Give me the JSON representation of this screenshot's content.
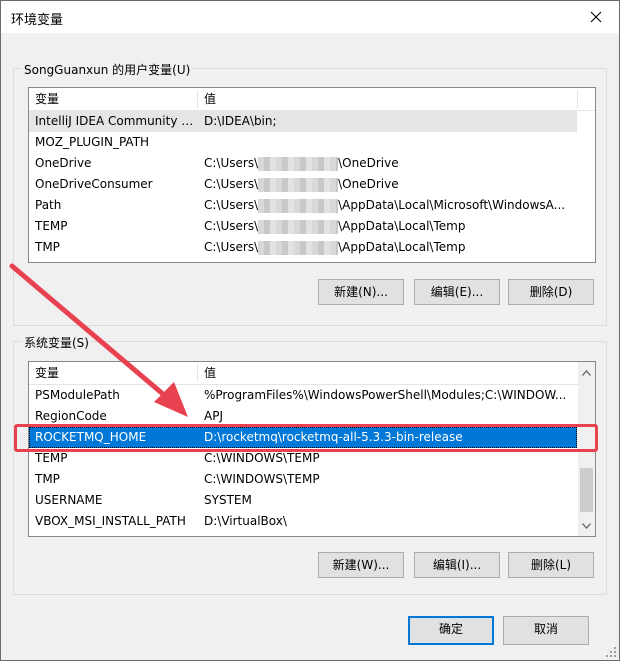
{
  "window": {
    "title": "环境变量"
  },
  "user_vars": {
    "group_label": "SongGuanxun 的用户变量(U)",
    "columns": [
      "变量",
      "值"
    ],
    "rows": [
      {
        "name": "IntelliJ IDEA Community E...",
        "value_prefix": "D:\\IDEA\\bin;",
        "value_suffix": "",
        "masked": false
      },
      {
        "name": "MOZ_PLUGIN_PATH",
        "value_prefix": "",
        "value_suffix": "",
        "masked": false
      },
      {
        "name": "OneDrive",
        "value_prefix": "C:\\Users\\",
        "value_suffix": "\\OneDrive",
        "masked": true
      },
      {
        "name": "OneDriveConsumer",
        "value_prefix": "C:\\Users\\",
        "value_suffix": "\\OneDrive",
        "masked": true
      },
      {
        "name": "Path",
        "value_prefix": "C:\\Users\\",
        "value_suffix": "\\AppData\\Local\\Microsoft\\WindowsA...",
        "masked": true
      },
      {
        "name": "TEMP",
        "value_prefix": "C:\\Users\\",
        "value_suffix": "\\AppData\\Local\\Temp",
        "masked": true
      },
      {
        "name": "TMP",
        "value_prefix": "C:\\Users\\",
        "value_suffix": "\\AppData\\Local\\Temp",
        "masked": true
      }
    ],
    "buttons": {
      "new": "新建(N)...",
      "edit": "编辑(E)...",
      "delete": "删除(D)"
    }
  },
  "system_vars": {
    "group_label": "系统变量(S)",
    "columns": [
      "变量",
      "值"
    ],
    "rows": [
      {
        "name": "PSModulePath",
        "value": "%ProgramFiles%\\WindowsPowerShell\\Modules;C:\\WINDOW..."
      },
      {
        "name": "RegionCode",
        "value": "APJ"
      },
      {
        "name": "ROCKETMQ_HOME",
        "value": "D:\\rocketmq\\rocketmq-all-5.3.3-bin-release"
      },
      {
        "name": "TEMP",
        "value": "C:\\WINDOWS\\TEMP"
      },
      {
        "name": "TMP",
        "value": "C:\\WINDOWS\\TEMP"
      },
      {
        "name": "USERNAME",
        "value": "SYSTEM"
      },
      {
        "name": "VBOX_MSI_INSTALL_PATH",
        "value": "D:\\VirtualBox\\"
      }
    ],
    "selected_index": 2,
    "buttons": {
      "new": "新建(W)...",
      "edit": "编辑(I)...",
      "delete": "删除(L)"
    }
  },
  "footer": {
    "ok": "确定",
    "cancel": "取消"
  },
  "colors": {
    "selection": "#0078d7",
    "annotation": "#e8414f"
  }
}
